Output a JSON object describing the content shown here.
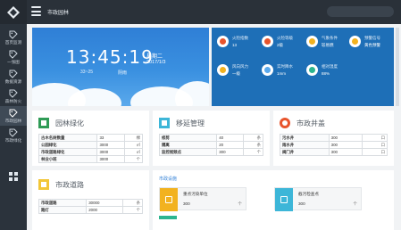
{
  "app": {
    "title": "市政园林",
    "brand_color": "#2a3139"
  },
  "sidebar": {
    "items": [
      {
        "label": "首页监测",
        "icon": "tag-icon"
      },
      {
        "label": "一张图",
        "icon": "tag-icon"
      },
      {
        "label": "数据资源",
        "icon": "tag-icon"
      },
      {
        "label": "森林防火",
        "icon": "tag-icon"
      },
      {
        "label": "市政园林",
        "icon": "tag-icon",
        "active": true
      },
      {
        "label": "市政绿化",
        "icon": "tag-icon"
      }
    ],
    "grid_icon": "grid-icon"
  },
  "banner": {
    "time": "13:45:19",
    "weekday": "星期二",
    "date": "2017/1/3",
    "temperature": "33~25",
    "bank_label": "阴雨"
  },
  "weather": {
    "items": [
      {
        "name": "火险指数",
        "value": "13",
        "color": "#e8542c"
      },
      {
        "name": "火险等级",
        "value": "2级",
        "color": "#e8542c"
      },
      {
        "name": "气象条件",
        "value": "较易燃",
        "color": "#f2b21f"
      },
      {
        "name": "预警信号",
        "value": "黄色预警",
        "color": "#f2b21f"
      },
      {
        "name": "风向风力",
        "value": "一级",
        "color": "#f2b21f"
      },
      {
        "name": "实时降水",
        "value": "1mm",
        "color": "#5aa9ec"
      },
      {
        "name": "相对湿度",
        "value": "88%",
        "color": "#2cb58f"
      }
    ]
  },
  "cards": {
    "garden": {
      "title": "园林绿化",
      "icon_color": "#2f9b56",
      "rows": [
        [
          "古木名树数量",
          "33",
          "棵"
        ],
        [
          "公园绿化",
          "3000",
          "㎡"
        ],
        [
          "市政道路绿化",
          "3000",
          "㎡"
        ],
        [
          "林业小班",
          "3000",
          "个"
        ]
      ]
    },
    "repair": {
      "title": "移延管理",
      "icon_color": "#3db6d8",
      "rows": [
        [
          "修剪",
          "40",
          "条"
        ],
        [
          "隔离",
          "20",
          "条"
        ],
        [
          "监控视频点",
          "300",
          "个"
        ]
      ]
    },
    "wells": {
      "title": "市政井盖",
      "icon_color": "#e8542c",
      "rows": [
        [
          "污水井",
          "300",
          "口"
        ],
        [
          "雨水井",
          "300",
          "口"
        ],
        [
          "阀门井",
          "300",
          "口"
        ]
      ]
    },
    "roads": {
      "title": "市政道路",
      "icon_color": "#f2c637",
      "rows": [
        [
          "市政道路",
          "30000",
          "条"
        ],
        [
          "路灯",
          "2000",
          "个"
        ]
      ]
    },
    "facilities": {
      "title": "市政设施",
      "items": [
        {
          "name": "重点污染单位",
          "value": "300",
          "unit": "个",
          "color": "#f2b21f"
        },
        {
          "name": "截污检查点",
          "value": "300",
          "unit": "个",
          "color": "#3db6d8"
        }
      ]
    }
  }
}
